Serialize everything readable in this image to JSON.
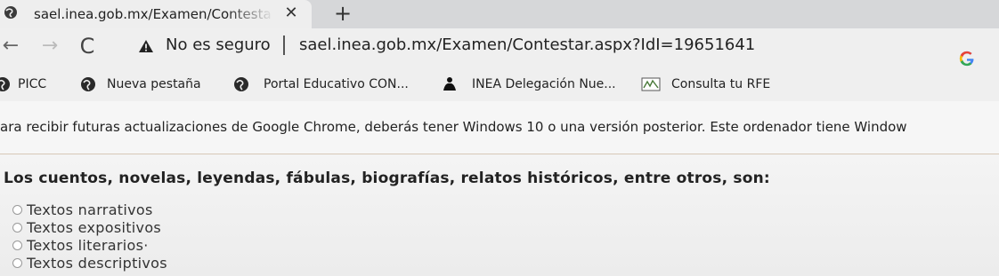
{
  "tab": {
    "title": "sael.inea.gob.mx/Examen/Contesta",
    "close": "✕",
    "new_tab": "+"
  },
  "toolbar": {
    "back": "←",
    "forward": "→",
    "reload": "C",
    "security_label": "No es seguro",
    "url": "sael.inea.gob.mx/Examen/Contestar.aspx?IdI=19651641"
  },
  "bookmarks": [
    {
      "label": "PICC",
      "icon": "globe-icon"
    },
    {
      "label": "Nueva pestaña",
      "icon": "globe-icon"
    },
    {
      "label": "Portal Educativo CON...",
      "icon": "globe-icon"
    },
    {
      "label": "INEA Delegación Nue...",
      "icon": "inea-icon"
    },
    {
      "label": "Consulta tu RFE",
      "icon": "rfe-icon"
    }
  ],
  "infobar": {
    "message": "ara recibir futuras actualizaciones de Google Chrome, deberás tener Windows 10 o una versión posterior. Este ordenador tiene Window"
  },
  "exam": {
    "question": "Los cuentos, novelas, leyendas, fábulas, biografías, relatos históricos, entre otros, son:",
    "options": [
      {
        "label": "Textos narrativos"
      },
      {
        "label": "Textos expositivos"
      },
      {
        "label": "Textos literarios·"
      },
      {
        "label": "Textos descriptivos"
      }
    ]
  },
  "colors": {
    "tab_bg": "#eeeeee",
    "tabstrip_bg": "#d6d7d9",
    "toolbar_bg": "#efefef",
    "google_blue": "#4285f4",
    "google_red": "#ea4335",
    "google_yellow": "#fbbc05",
    "google_green": "#34a853"
  }
}
